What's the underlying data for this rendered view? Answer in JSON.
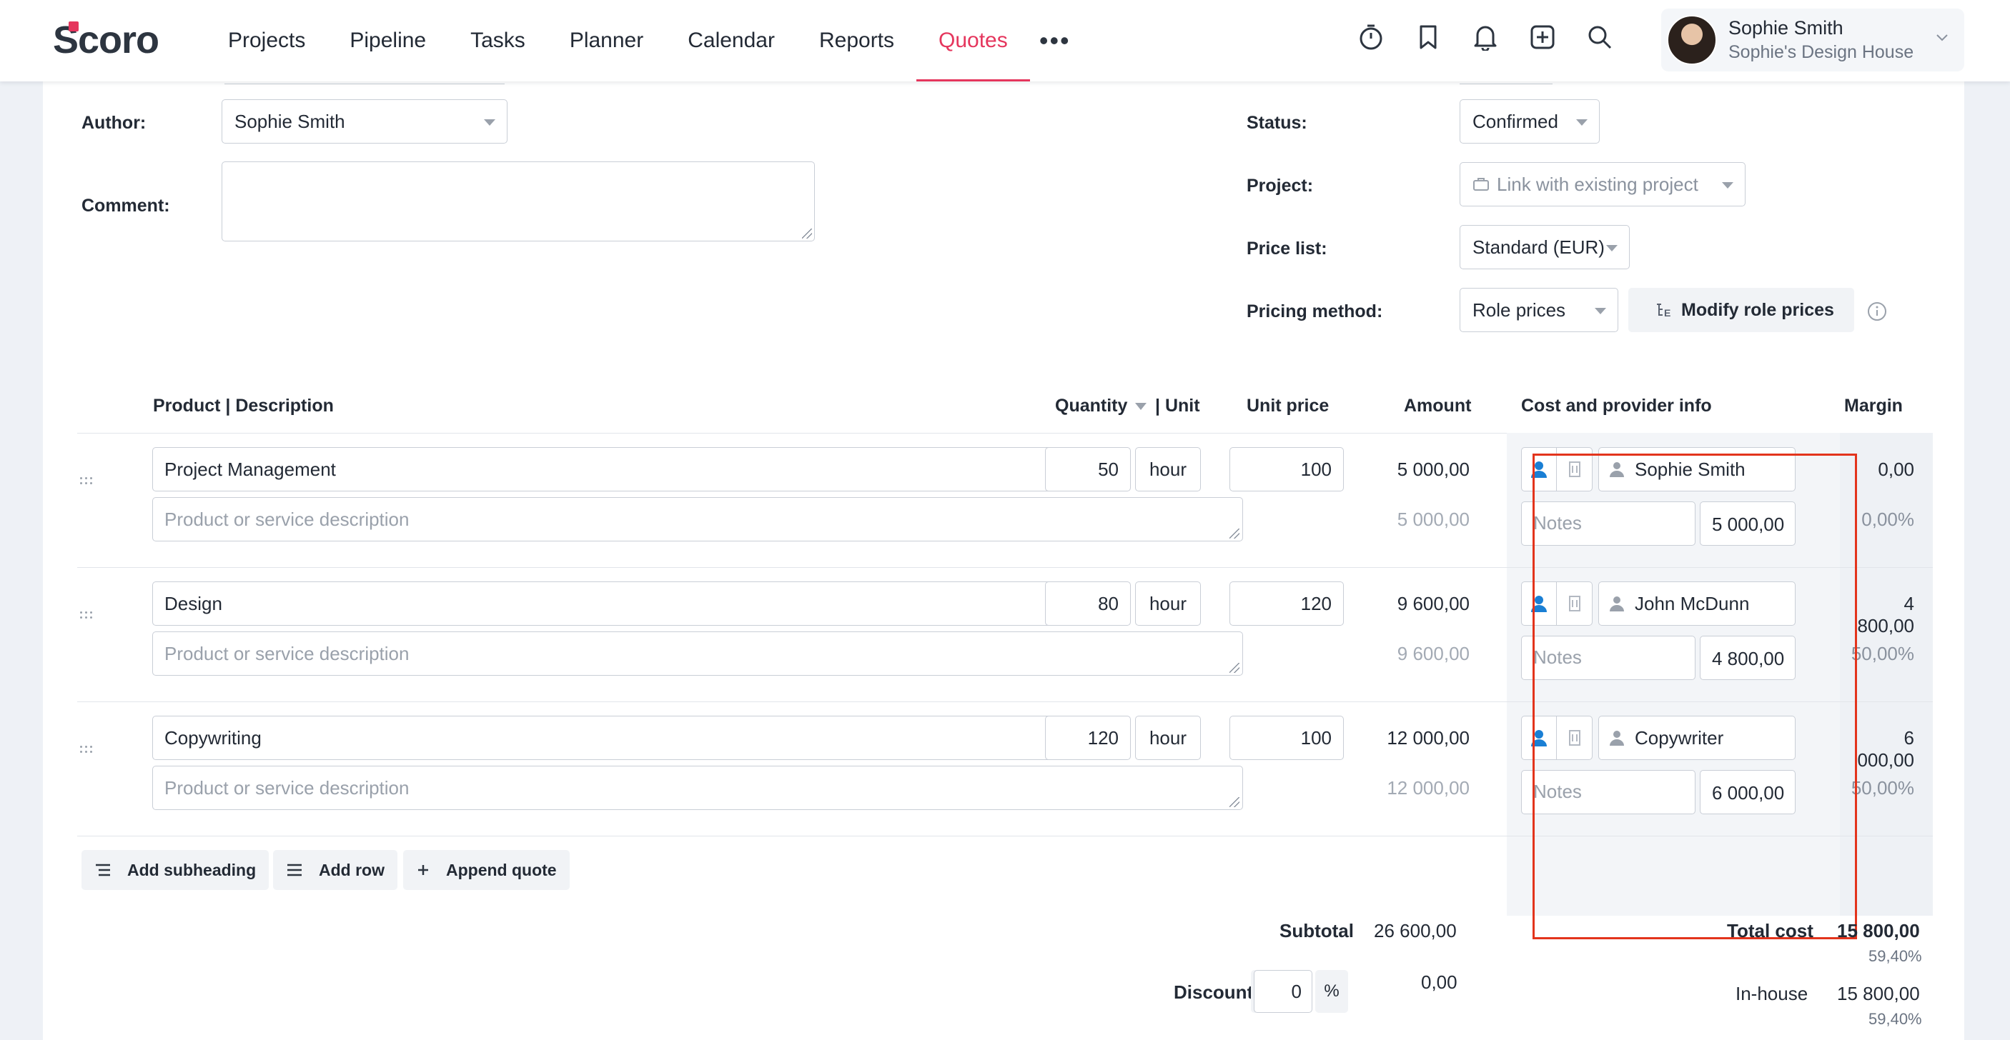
{
  "app": {
    "logo": "Scoro"
  },
  "nav": {
    "items": [
      "Projects",
      "Pipeline",
      "Tasks",
      "Planner",
      "Calendar",
      "Reports",
      "Quotes"
    ],
    "active": "Quotes",
    "more": "•••"
  },
  "user": {
    "name": "Sophie Smith",
    "org": "Sophie's Design House"
  },
  "form": {
    "author_label": "Author:",
    "author_value": "Sophie Smith",
    "comment_label": "Comment:",
    "status_label": "Status:",
    "status_value": "Confirmed",
    "project_label": "Project:",
    "project_placeholder": "Link with existing project",
    "pricelist_label": "Price list:",
    "pricelist_value": "Standard (EUR)",
    "pricing_label": "Pricing method:",
    "pricing_value": "Role prices",
    "modify_button": "Modify role prices"
  },
  "table": {
    "headers": {
      "product": "Product | Description",
      "quantity": "Quantity",
      "unit": "| Unit",
      "unit_price": "Unit price",
      "amount": "Amount",
      "cost": "Cost and provider info",
      "margin": "Margin"
    },
    "description_placeholder": "Product or service description",
    "notes_placeholder": "Notes",
    "rows": [
      {
        "product": "Project Management",
        "qty": "50",
        "unit": "hour",
        "price": "100",
        "amount": "5 000,00",
        "amount_sub": "5 000,00",
        "provider": "Sophie Smith",
        "cost": "5 000,00",
        "margin": "0,00",
        "margin_pct": "0,00%"
      },
      {
        "product": "Design",
        "qty": "80",
        "unit": "hour",
        "price": "120",
        "amount": "9 600,00",
        "amount_sub": "9 600,00",
        "provider": "John McDunn",
        "cost": "4 800,00",
        "margin": "4 800,00",
        "margin_pct": "50,00%"
      },
      {
        "product": "Copywriting",
        "qty": "120",
        "unit": "hour",
        "price": "100",
        "amount": "12 000,00",
        "amount_sub": "12 000,00",
        "provider": "Copywriter",
        "cost": "6 000,00",
        "margin": "6 000,00",
        "margin_pct": "50,00%"
      }
    ]
  },
  "actions": {
    "add_subheading": "Add subheading",
    "add_row": "Add row",
    "append_quote": "Append quote"
  },
  "totals": {
    "subtotal_label": "Subtotal",
    "subtotal_value": "26 600,00",
    "discount_label": "Discount",
    "discount_sign": "-",
    "discount_value": "0",
    "discount_unit": "%",
    "discount_amount": "0,00",
    "total_cost_label": "Total cost",
    "total_cost_value": "15 800,00",
    "total_cost_pct": "59,40%",
    "inhouse_label": "In-house",
    "inhouse_value": "15 800,00",
    "inhouse_pct": "59,40%"
  },
  "colors": {
    "accent": "#e5365d",
    "highlight_border": "#e3341c",
    "icon_blue": "#1a7fd4"
  }
}
